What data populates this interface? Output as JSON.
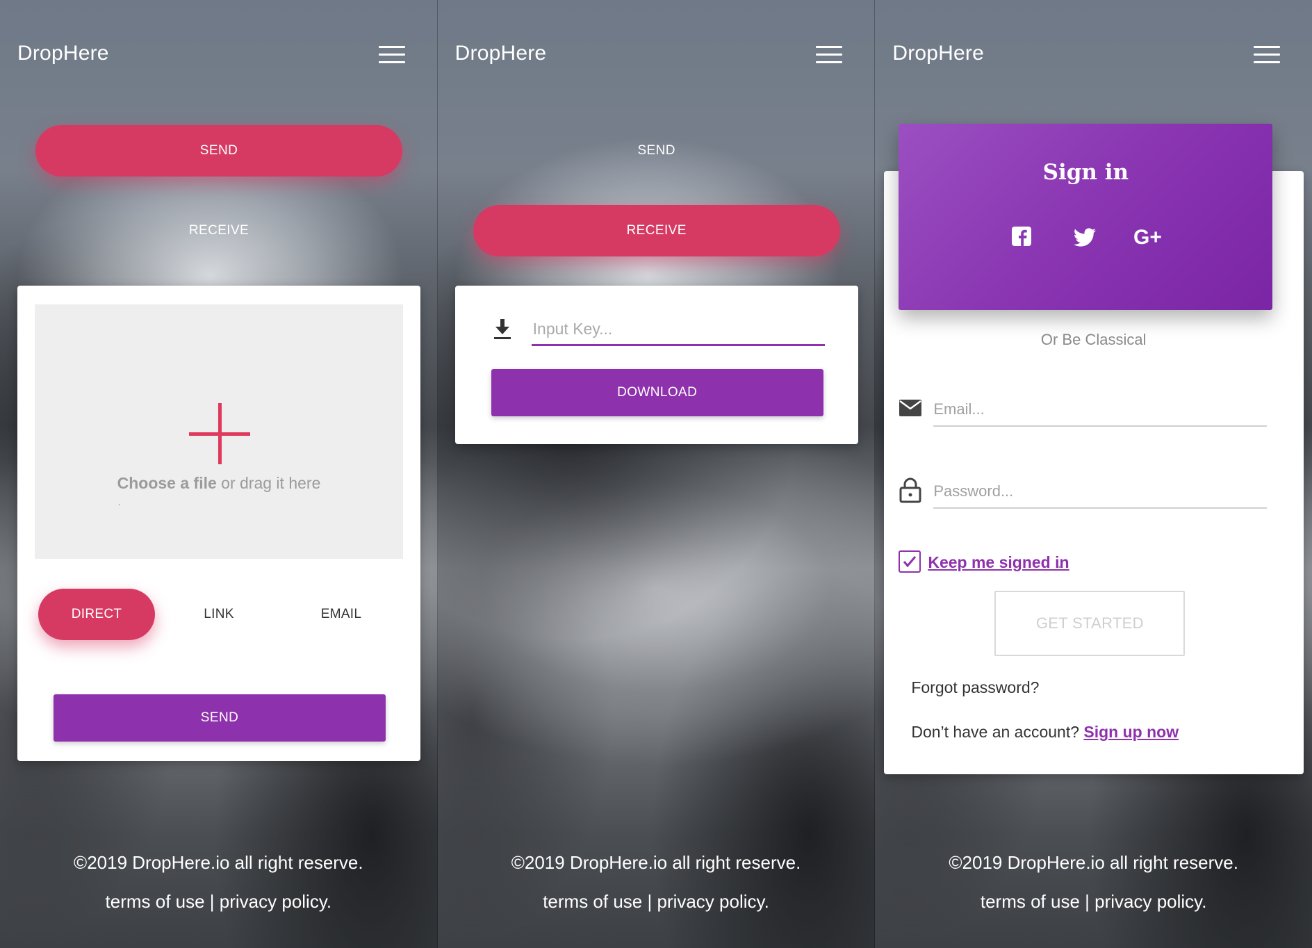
{
  "app": {
    "brand": "DropHere"
  },
  "colors": {
    "accent_pink": "#d63a63",
    "accent_purple": "#8e31ad"
  },
  "screen1": {
    "send_tab": "SEND",
    "receive_tab": "RECEIVE",
    "drop_bold": "Choose a file",
    "drop_rest": " or drag it here",
    "drop_dot": ".",
    "modes": [
      "DIRECT",
      "LINK",
      "EMAIL"
    ],
    "active_mode": "DIRECT",
    "send_button": "SEND"
  },
  "screen2": {
    "send_tab": "SEND",
    "receive_tab": "RECEIVE",
    "key_placeholder": "Input Key...",
    "download_button": "DOWNLOAD",
    "download_icon": "download-icon"
  },
  "screen3": {
    "sign_in_title": "Sign in",
    "social_icons": [
      "facebook-icon",
      "twitter-icon",
      "google-plus-icon"
    ],
    "or_classical": "Or Be Classical",
    "email_placeholder": "Email...",
    "password_placeholder": "Password...",
    "keep_signed_in": "Keep me signed in",
    "keep_signed_in_checked": true,
    "keep_dot": ".",
    "get_started": "GET STARTED",
    "forgot_password": "Forgot password?",
    "no_account": "Don’t have an account? ",
    "sign_up": "Sign up now"
  },
  "footer": {
    "copyright": "©2019 DropHere.io all right reserve.",
    "terms": "terms of use",
    "separator": " | ",
    "privacy": "privacy policy."
  }
}
